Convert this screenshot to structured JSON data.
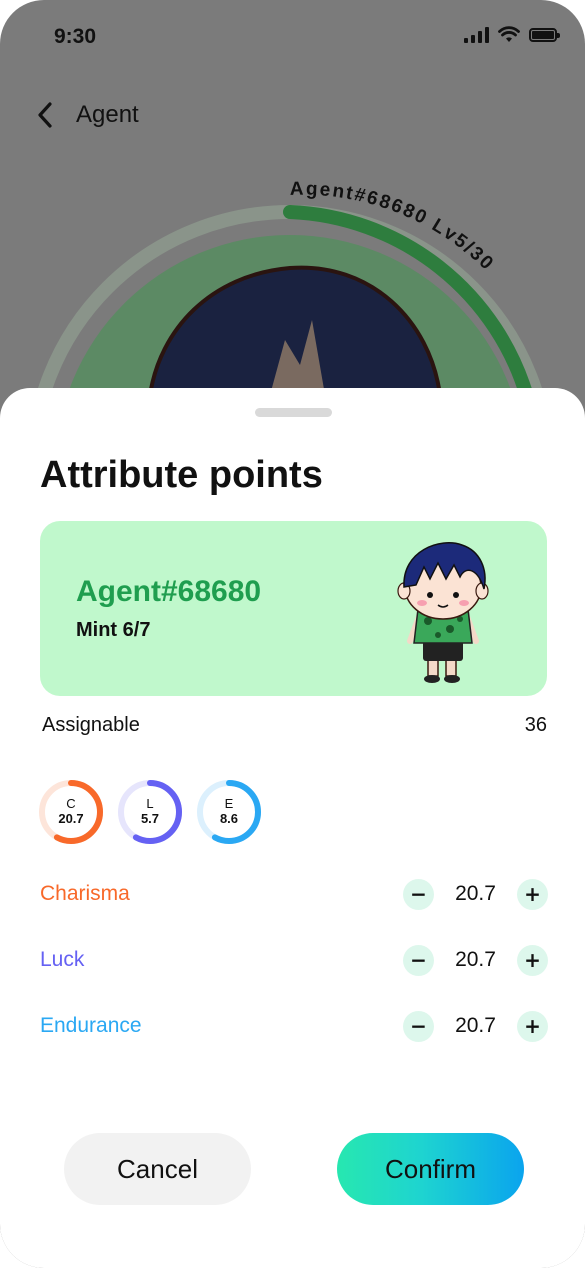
{
  "status_bar": {
    "time": "9:30",
    "icons": [
      "signal-icon",
      "wifi-icon",
      "battery-icon"
    ]
  },
  "nav": {
    "back_icon": "chevron-left-icon",
    "title": "Agent"
  },
  "background": {
    "arc_label": "Agent#68680 Lv5/30",
    "level": {
      "current": 5,
      "max": 30
    },
    "colors": {
      "overlay": "#7b7b7b",
      "arc": "#2e7d3e"
    }
  },
  "sheet": {
    "title": "Attribute points",
    "card": {
      "name": "Agent#68680",
      "mint": "Mint 6/7",
      "background": "#c0f8cc",
      "name_color": "#1f9e4f"
    },
    "assignable": {
      "label": "Assignable",
      "value": "36"
    },
    "rings": [
      {
        "letter": "C",
        "value": "20.7",
        "fraction": 0.58,
        "color": "#f8692a",
        "track": "#fde5da"
      },
      {
        "letter": "L",
        "value": "5.7",
        "fraction": 0.58,
        "color": "#6561f3",
        "track": "#e6e5fc"
      },
      {
        "letter": "E",
        "value": "8.6",
        "fraction": 0.58,
        "color": "#2aa8f3",
        "track": "#dcf0fd"
      }
    ],
    "attributes": [
      {
        "label": "Charisma",
        "value": "20.7",
        "color": "#f8692a",
        "minus": "−",
        "plus": "+"
      },
      {
        "label": "Luck",
        "value": "20.7",
        "color": "#6561f3",
        "minus": "−",
        "plus": "+"
      },
      {
        "label": "Endurance",
        "value": "20.7",
        "color": "#2aa8f3",
        "minus": "−",
        "plus": "+"
      }
    ],
    "buttons": {
      "cancel": "Cancel",
      "confirm": "Confirm"
    }
  }
}
